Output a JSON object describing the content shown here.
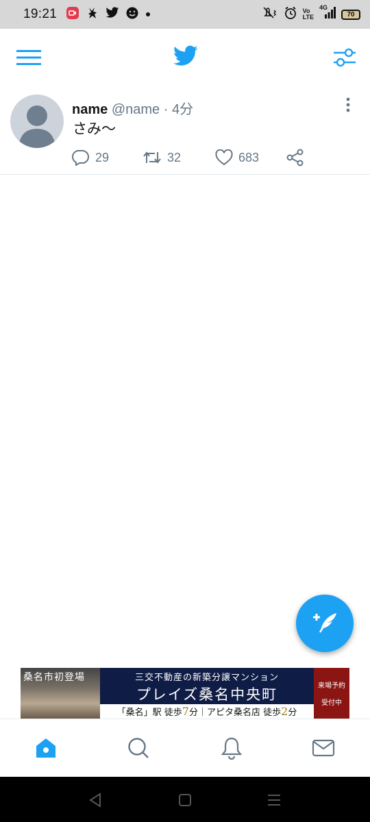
{
  "status_bar": {
    "time": "19:21",
    "battery": "70",
    "network_top": "Vo",
    "network_bottom": "LTE",
    "network_type": "4G",
    "left_icons": [
      "screen-record-icon",
      "rabbit-app-icon",
      "twitter-bird-icon",
      "smiley-app-icon",
      "dot-icon"
    ],
    "right_icons": [
      "vibrate-mute-icon",
      "alarm-icon",
      "signal-icon",
      "battery-icon"
    ]
  },
  "header": {
    "menu_icon": "hamburger-menu-icon",
    "logo_icon": "twitter-bird-icon",
    "filter_icon": "filter-sliders-icon",
    "accent_color": "#1da1f2"
  },
  "tweet": {
    "name": "name",
    "handle": "@name",
    "separator": "·",
    "time": "4分",
    "text": "さみ〜",
    "more_icon": "more-vertical-icon",
    "replies": "29",
    "retweets": "32",
    "likes": "683"
  },
  "fab": {
    "icon": "compose-tweet-icon",
    "color": "#1da1f2"
  },
  "ad": {
    "left_label": "桑名市初登場",
    "line1": "三交不動産の新築分譲マンション",
    "line2": "プレイズ桑名中央町",
    "station_part": "「桑名」駅 徒歩",
    "station_minutes": "7",
    "station_unit": "分",
    "store_part": "｜アピタ桑名店 徒歩",
    "store_minutes": "2",
    "store_unit": "分",
    "right_line1": "来場予約",
    "right_line2": "受付中"
  },
  "bottom_nav": {
    "items": [
      "home-icon",
      "search-icon",
      "notifications-icon",
      "messages-icon"
    ],
    "active": "home-icon"
  },
  "system_nav": {
    "items": [
      "back-icon",
      "home-square-icon",
      "recents-icon"
    ]
  }
}
